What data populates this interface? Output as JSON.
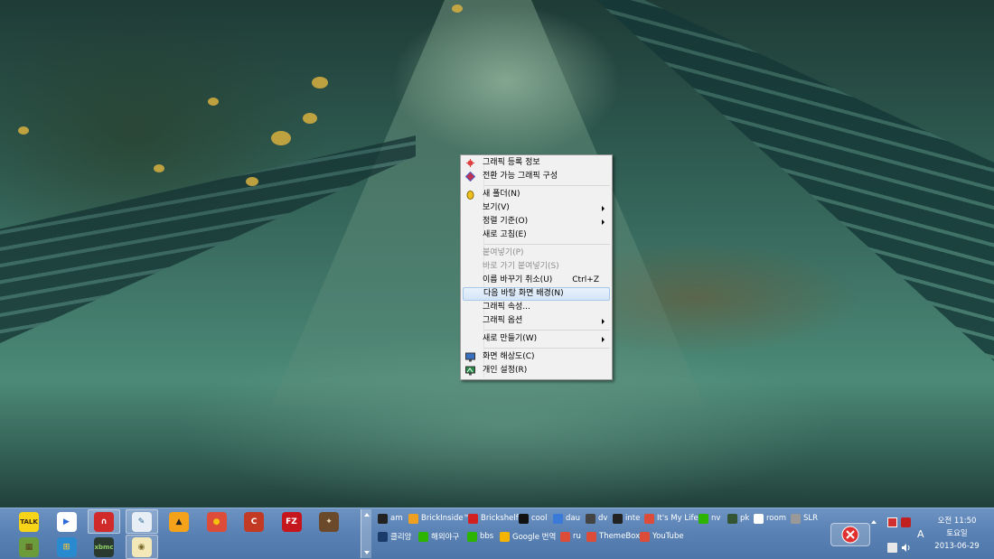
{
  "context_menu": {
    "items": [
      {
        "label": "그래픽 등록 정보",
        "icon": "graphics-properties-icon"
      },
      {
        "label": "전환 가능 그래픽 구성",
        "icon": "switchable-graphics-icon"
      },
      {
        "label": "새 폴더(N)",
        "icon": "new-folder-icon"
      },
      {
        "label": "보기(V)",
        "submenu": true
      },
      {
        "label": "정렬 기준(O)",
        "submenu": true
      },
      {
        "label": "새로 고침(E)"
      },
      {
        "label": "붙여넣기(P)",
        "disabled": true
      },
      {
        "label": "바로 가기 붙여넣기(S)",
        "disabled": true
      },
      {
        "label": "이름 바꾸기 취소(U)",
        "shortcut": "Ctrl+Z"
      },
      {
        "label": "다음 바탕 화면 배경(N)",
        "highlighted": true
      },
      {
        "label": "그래픽 속성..."
      },
      {
        "label": "그래픽 옵션",
        "submenu": true
      },
      {
        "label": "새로 만들기(W)",
        "submenu": true
      },
      {
        "label": "화면 해상도(C)",
        "icon": "screen-resolution-icon"
      },
      {
        "label": "개인 설정(R)",
        "icon": "personalize-icon"
      }
    ]
  },
  "taskbar": {
    "pinned_row1": [
      {
        "name": "kakaotalk",
        "label": "TALK",
        "color": "#f7d417",
        "fg": "#3a2a1a"
      },
      {
        "name": "daum-potplayer",
        "label": "▶",
        "color": "#ffffff",
        "fg": "#2b6ad9"
      },
      {
        "name": "magnet",
        "label": "∩",
        "color": "#d02a2a",
        "fg": "#ffffff",
        "active": true
      },
      {
        "name": "notepad",
        "label": "✎",
        "color": "#e8eef5",
        "fg": "#2a6a9a",
        "active": true
      },
      {
        "name": "aimp",
        "label": "▲",
        "color": "#f3a21a",
        "fg": "#222222"
      },
      {
        "name": "chrome",
        "label": "●",
        "color": "#dd4b39",
        "fg": "#f4c20d"
      },
      {
        "name": "ccleaner",
        "label": "C",
        "color": "#c23a24",
        "fg": "#ffffff"
      },
      {
        "name": "filezilla",
        "label": "FZ",
        "color": "#c4161c",
        "fg": "#ffffff"
      },
      {
        "name": "tool",
        "label": "✦",
        "color": "#6a4a2a",
        "fg": "#e8d8b0"
      }
    ],
    "pinned_row2": [
      {
        "name": "minecraft",
        "label": "▦",
        "color": "#6b9b3a",
        "fg": "#5a3a1a"
      },
      {
        "name": "windows",
        "label": "⊞",
        "color": "#2a8ad0",
        "fg": "#f6c23a"
      },
      {
        "name": "xbmc",
        "label": "xbmc",
        "color": "#2a3a30",
        "fg": "#8fcf6a"
      },
      {
        "name": "chat",
        "label": "◉",
        "color": "#f3e8b8",
        "fg": "#7a6a2a",
        "active": true
      }
    ],
    "links_row1": [
      {
        "label": "am",
        "fav": "#222222"
      },
      {
        "label": "BrickInside™",
        "fav": "#f0a020"
      },
      {
        "label": "Brickshelf",
        "fav": "#d02020"
      },
      {
        "label": "cool",
        "fav": "#111111"
      },
      {
        "label": "dau",
        "fav": "#3a7ad8"
      },
      {
        "label": "dv",
        "fav": "#444444"
      },
      {
        "label": "inte",
        "fav": "#222222"
      },
      {
        "label": "It's My Life",
        "fav": "#dd4b39"
      },
      {
        "label": "nv",
        "fav": "#2db400"
      },
      {
        "label": "pk",
        "fav": "#335533"
      },
      {
        "label": "room",
        "fav": "#ffffff"
      },
      {
        "label": "SLR",
        "fav": "#999999"
      }
    ],
    "links_row2": [
      {
        "label": "클리앙",
        "fav": "#1a3a6a"
      },
      {
        "label": "해외야구",
        "fav": "#2db400"
      },
      {
        "label": "bbs",
        "fav": "#2db400"
      },
      {
        "label": "Google 번역",
        "fav": "#f4b400"
      },
      {
        "label": "ru",
        "fav": "#dd4b39"
      },
      {
        "label": "ThemeBox",
        "fav": "#dd4b39"
      },
      {
        "label": "YouTube",
        "fav": "#dd4b39"
      }
    ],
    "tray": {
      "ime": "A",
      "time": "오전 11:50",
      "weekday": "토요일",
      "date": "2013-06-29"
    }
  }
}
